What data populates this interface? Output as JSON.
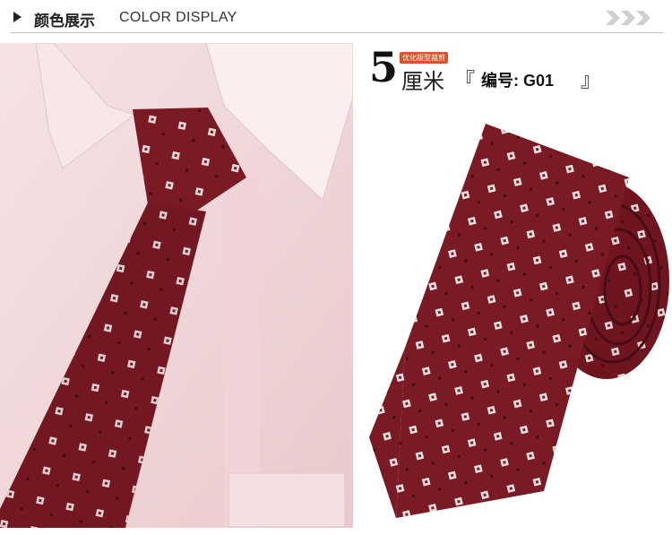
{
  "header": {
    "title_cn": "颜色展示",
    "title_en": "COLOR DISPLAY"
  },
  "product": {
    "badge": "优化版型裁剪",
    "size_number": "5",
    "size_unit": "厘米",
    "bracket_open": "『",
    "code": "编号: G01",
    "bracket_close": "』"
  },
  "colors": {
    "tie_burgundy": "#7a1a24",
    "tie_dark": "#5a0f18",
    "shirt_pink": "#f1d6d8",
    "badge_orange": "#e0502a"
  }
}
